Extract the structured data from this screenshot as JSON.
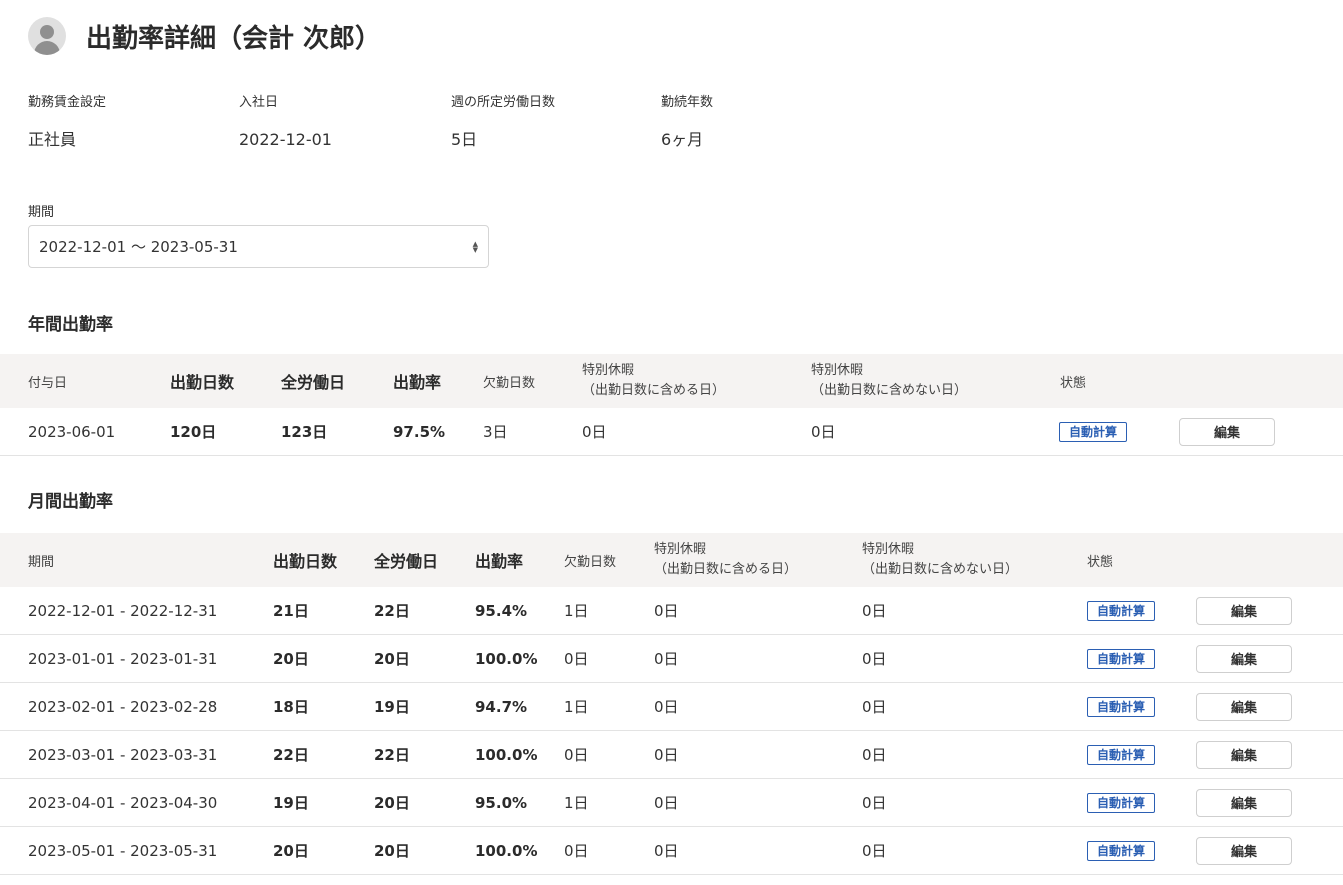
{
  "header": {
    "title": "出勤率詳細（会計 次郎）",
    "avatar_icon": "user-avatar-icon"
  },
  "info": [
    {
      "label": "勤務賃金設定",
      "value": "正社員"
    },
    {
      "label": "入社日",
      "value": "2022-12-01"
    },
    {
      "label": "週の所定労働日数",
      "value": "5日"
    },
    {
      "label": "勤続年数",
      "value": "6ヶ月"
    }
  ],
  "period": {
    "label": "期間",
    "selected": "2022-12-01 〜 2023-05-31"
  },
  "annual": {
    "title": "年間出勤率",
    "headers": {
      "grant_date": "付与日",
      "attended": "出勤日数",
      "total": "全労働日",
      "rate": "出勤率",
      "absent": "欠勤日数",
      "special_in_1": "特別休暇",
      "special_in_2": "（出勤日数に含める日）",
      "special_ex_1": "特別休暇",
      "special_ex_2": "（出勤日数に含めない日）",
      "status": "状態"
    },
    "rows": [
      {
        "grant_date": "2023-06-01",
        "attended": "120日",
        "total": "123日",
        "rate": "97.5%",
        "absent": "3日",
        "special_in": "0日",
        "special_ex": "0日",
        "status": "自動計算",
        "action": "編集"
      }
    ]
  },
  "monthly": {
    "title": "月間出勤率",
    "headers": {
      "period": "期間",
      "attended": "出勤日数",
      "total": "全労働日",
      "rate": "出勤率",
      "absent": "欠勤日数",
      "special_in_1": "特別休暇",
      "special_in_2": "（出勤日数に含める日）",
      "special_ex_1": "特別休暇",
      "special_ex_2": "（出勤日数に含めない日）",
      "status": "状態"
    },
    "rows": [
      {
        "period": "2022-12-01 - 2022-12-31",
        "attended": "21日",
        "total": "22日",
        "rate": "95.4%",
        "absent": "1日",
        "special_in": "0日",
        "special_ex": "0日",
        "status": "自動計算",
        "action": "編集"
      },
      {
        "period": "2023-01-01 - 2023-01-31",
        "attended": "20日",
        "total": "20日",
        "rate": "100.0%",
        "absent": "0日",
        "special_in": "0日",
        "special_ex": "0日",
        "status": "自動計算",
        "action": "編集"
      },
      {
        "period": "2023-02-01 - 2023-02-28",
        "attended": "18日",
        "total": "19日",
        "rate": "94.7%",
        "absent": "1日",
        "special_in": "0日",
        "special_ex": "0日",
        "status": "自動計算",
        "action": "編集"
      },
      {
        "period": "2023-03-01 - 2023-03-31",
        "attended": "22日",
        "total": "22日",
        "rate": "100.0%",
        "absent": "0日",
        "special_in": "0日",
        "special_ex": "0日",
        "status": "自動計算",
        "action": "編集"
      },
      {
        "period": "2023-04-01 - 2023-04-30",
        "attended": "19日",
        "total": "20日",
        "rate": "95.0%",
        "absent": "1日",
        "special_in": "0日",
        "special_ex": "0日",
        "status": "自動計算",
        "action": "編集"
      },
      {
        "period": "2023-05-01 - 2023-05-31",
        "attended": "20日",
        "total": "20日",
        "rate": "100.0%",
        "absent": "0日",
        "special_in": "0日",
        "special_ex": "0日",
        "status": "自動計算",
        "action": "編集"
      }
    ]
  },
  "colors": {
    "accent": "#2b5fb3",
    "header_bg": "#f5f3f2"
  }
}
